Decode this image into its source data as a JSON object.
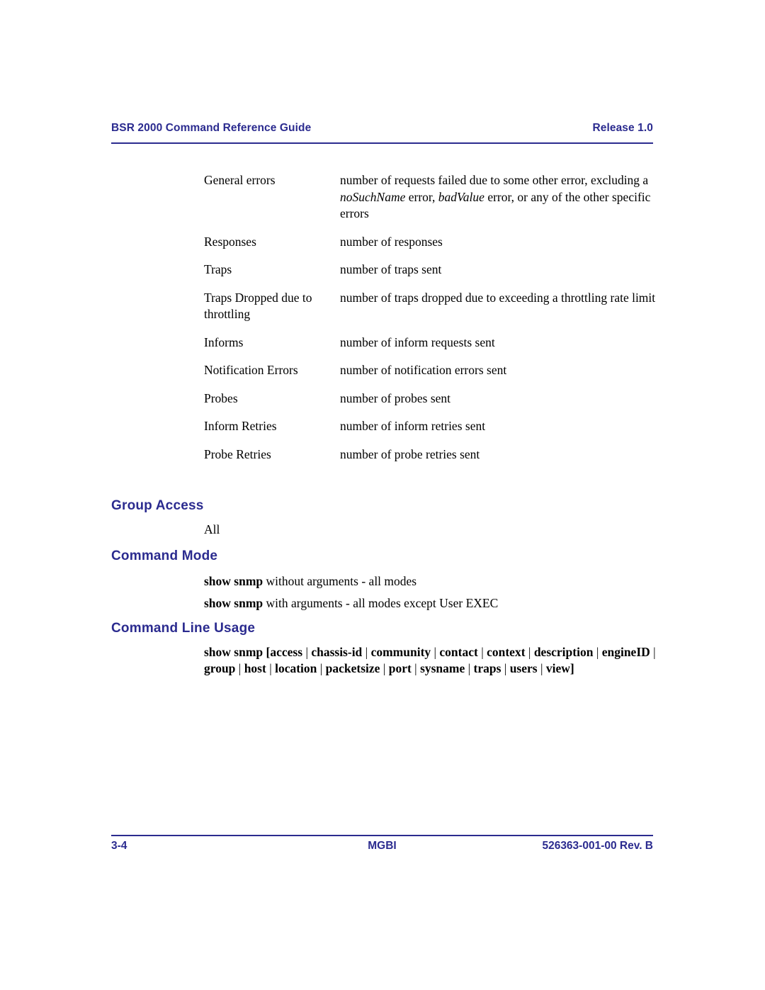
{
  "header": {
    "doc_title": "BSR 2000 Command Reference Guide",
    "release": "Release 1.0",
    "rule_color": "#2b2b8f"
  },
  "definition_table": {
    "rows": [
      {
        "term": "General errors",
        "desc_parts": [
          {
            "text": "number of requests failed due to some other error, excluding a ",
            "italic": false
          },
          {
            "text": "noSuchName",
            "italic": true
          },
          {
            "text": " error, ",
            "italic": false
          },
          {
            "text": "badValue",
            "italic": true
          },
          {
            "text": " error, or any of the other specific errors",
            "italic": false
          }
        ],
        "desc_plain": "number of requests failed due to some other error, excluding a noSuchName error, badValue error, or any of the other specific errors"
      },
      {
        "term": "Responses",
        "desc_parts": [
          {
            "text": "number of responses",
            "italic": false
          }
        ],
        "desc_plain": "number of responses"
      },
      {
        "term": "Traps",
        "desc_parts": [
          {
            "text": "number of traps sent",
            "italic": false
          }
        ],
        "desc_plain": "number of traps sent"
      },
      {
        "term": "Traps Dropped due to throttling",
        "desc_parts": [
          {
            "text": "number of traps dropped due to exceeding a throttling rate limit",
            "italic": false
          }
        ],
        "desc_plain": "number of traps dropped due to exceeding a throttling rate limit"
      },
      {
        "term": "Informs",
        "desc_parts": [
          {
            "text": "number of inform requests sent",
            "italic": false
          }
        ],
        "desc_plain": "number of inform requests sent"
      },
      {
        "term": "Notification Errors",
        "desc_parts": [
          {
            "text": "number of notification errors sent",
            "italic": false
          }
        ],
        "desc_plain": "number of notification errors sent"
      },
      {
        "term": "Probes",
        "desc_parts": [
          {
            "text": "number of probes sent",
            "italic": false
          }
        ],
        "desc_plain": "number of probes sent"
      },
      {
        "term": "Inform Retries",
        "desc_parts": [
          {
            "text": "number of inform retries sent",
            "italic": false
          }
        ],
        "desc_plain": "number of inform retries sent"
      },
      {
        "term": "Probe Retries",
        "desc_parts": [
          {
            "text": "number of probe retries sent",
            "italic": false
          }
        ],
        "desc_plain": "number of probe retries sent"
      }
    ]
  },
  "sections": {
    "group_access": {
      "heading": "Group Access",
      "body": "All"
    },
    "command_mode": {
      "heading": "Command Mode",
      "lines": [
        {
          "bold": "show snmp",
          "rest": " without arguments - all modes"
        },
        {
          "bold": "show snmp",
          "rest": " with arguments - all modes except User EXEC"
        }
      ]
    },
    "command_line_usage": {
      "heading": "Command Line Usage",
      "syntax": "show snmp [access | chassis-id | community | contact | context | description | engineID | group | host | location | packetsize | port | sysname | traps | users | view]",
      "command": "show snmp",
      "open_bracket": "[",
      "close_bracket": "]",
      "separator": "|",
      "options": [
        "access",
        "chassis-id",
        "community",
        "contact",
        "context",
        "description",
        "engineID",
        "group",
        "host",
        "location",
        "packetsize",
        "port",
        "sysname",
        "traps",
        "users",
        "view"
      ]
    }
  },
  "footer": {
    "page_number": "3-4",
    "organization": "MGBI",
    "part_number": "526363-001-00 Rev. B",
    "rule_color": "#2b2b8f"
  }
}
